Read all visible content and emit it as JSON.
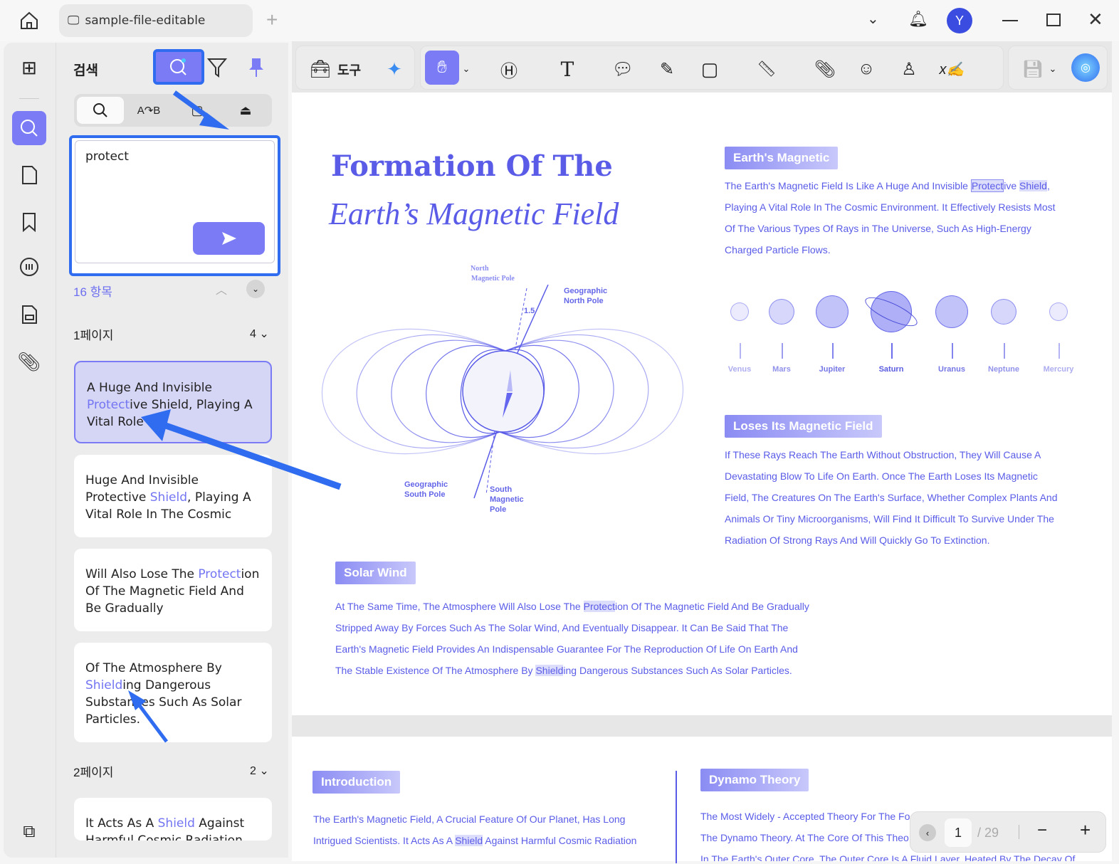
{
  "window": {
    "tab_title": "sample-file-editable",
    "avatar_letter": "Y"
  },
  "panel": {
    "title": "검색",
    "query": "protect",
    "result_count": "16 항목",
    "groups": [
      {
        "label": "1페이지",
        "count": "4"
      },
      {
        "label": "2페이지",
        "count": "2"
      }
    ],
    "results": [
      {
        "pre": "A Huge And Invisible ",
        "hit": "Protect",
        "post": "ive Shield, Playing A Vital Role"
      },
      {
        "pre": "Huge And Invisible Protective ",
        "hit": "Shield",
        "post": ", Playing A Vital Role In The Cosmic"
      },
      {
        "pre": "Will Also Lose The ",
        "hit": "Protect",
        "post": "ion Of The Magnetic Field And Be Gradually"
      },
      {
        "pre": "Of The Atmosphere By ",
        "hit": "Shield",
        "post": "ing Dangerous Substances Such As Solar Particles."
      },
      {
        "pre": "It Acts As A ",
        "hit": "Shield",
        "post": " Against Harmful Cosmic Radiation"
      }
    ]
  },
  "toolbar": {
    "tools_label": "도구"
  },
  "document": {
    "title1": "Formation Of The",
    "title2": "Earth’s Magnetic Field",
    "diagram": {
      "north_mag": "North",
      "north_mag2": "Magnetic Pole",
      "geo_north": "Geographic",
      "geo_north2": "North Pole",
      "angle": "1.5",
      "geo_south": "Geographic",
      "geo_south2": "South Pole",
      "south_mag": "South",
      "south_mag2": "Magnetic",
      "south_mag3": "Pole"
    },
    "s1_title": "Earth's Magnetic",
    "s1_a": "The Earth's Magnetic Field Is Like A Huge And Invisible ",
    "s1_hit1": "Protect",
    "s1_b": "ive ",
    "s1_hit2": "Shield",
    "s1_c": ",",
    "s1_lines": [
      "Playing A Vital Role In The Cosmic Environment. It Effectively Resists Most",
      "Of The Various Types Of Rays in The Universe, Such As High-Energy",
      "Charged Particle Flows."
    ],
    "planets": [
      "Venus",
      "Mars",
      "Jupiter",
      "Saturn",
      "Uranus",
      "Neptune",
      "Mercury"
    ],
    "s2_title": "Loses Its Magnetic Field",
    "s2_lines": [
      "If These Rays Reach The Earth Without Obstruction, They Will Cause A",
      "Devastating Blow To Life On Earth. Once The Earth Loses Its Magnetic",
      "Field, The Creatures On The Earth's Surface, Whether Complex Plants And",
      "Animals Or Tiny Microorganisms, Will Find It Difficult To Survive Under The",
      "Radiation Of Strong Rays And Will Quickly Go To Extinction."
    ],
    "s3_title": "Solar Wind",
    "s3_a": "At The Same Time, The Atmosphere Will Also Lose The ",
    "s3_hit1": "Protect",
    "s3_b": "ion Of The Magnetic Field And Be Gradually",
    "s3_l2": "Stripped Away By Forces Such As The Solar Wind, And Eventually Disappear. It Can Be Said That The",
    "s3_l3": "Earth's Magnetic Field Provides An Indispensable Guarantee For The Reproduction Of Life On Earth And",
    "s3_c": "The Stable Existence Of The Atmosphere By ",
    "s3_hit2": "Shield",
    "s3_d": "ing Dangerous Substances Such As Solar Particles.",
    "p2_intro": "Introduction",
    "p2_l1": "The Earth's Magnetic Field, A Crucial Feature Of Our Planet, Has Long",
    "p2_a": "Intrigued Scientists. It Acts As A ",
    "p2_hit": "Shield",
    "p2_b": " Against Harmful Cosmic Radiation",
    "p2_dynamo": "Dynamo Theory",
    "p2_d1": "The Most Widely - Accepted Theory For The Fo",
    "p2_d2": "The Dynamo Theory. At The Core Of This Theo",
    "p2_d3": "In The Earth's Outer Core, The Outer Core Is A Fluid Layer, Heated By The Decay Of"
  },
  "nav": {
    "page": "1",
    "total": "/ 29"
  },
  "colors": {
    "accent": "#7b7cf5",
    "annotation": "#2f6cf0",
    "doc_text": "#5a5ce8"
  }
}
